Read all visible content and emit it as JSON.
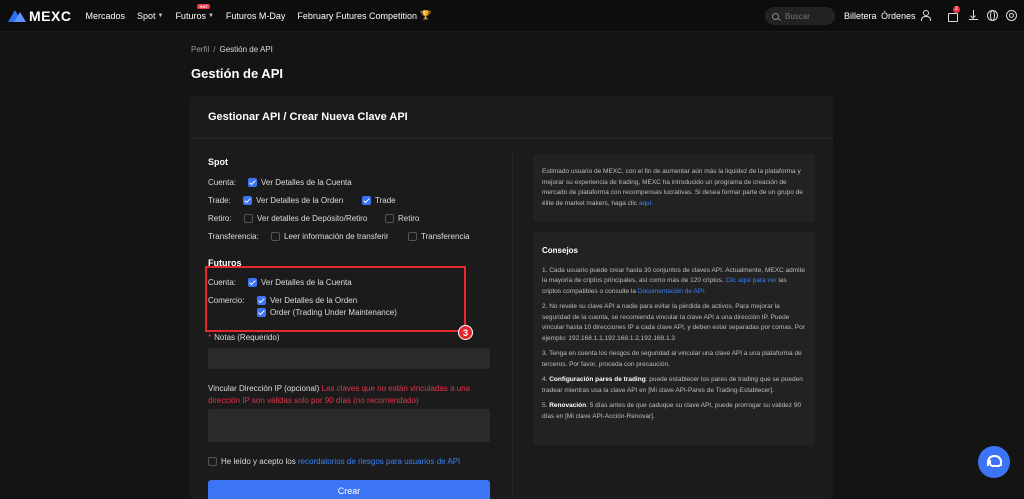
{
  "nav": {
    "logo": "MEXC",
    "items": [
      "Mercados",
      "Spot",
      "Futuros",
      "Futuros M-Day",
      "February Futures Competition"
    ],
    "hot_badge": "HOT",
    "search_placeholder": "Buscar",
    "wallet": "Billetera",
    "orders": "Órdenes",
    "notification_count": "2"
  },
  "breadcrumb": {
    "parent": "Perfil",
    "separator": "/",
    "current": "Gestión de API"
  },
  "page_title": "Gestión de API",
  "panel_title": "Gestionar API / Crear Nueva Clave API",
  "spot": {
    "title": "Spot",
    "cuenta_label": "Cuenta:",
    "cuenta_option": "Ver Detalles de la Cuenta",
    "trade_label": "Trade:",
    "trade_option1": "Ver Detalles de la Orden",
    "trade_option2": "Trade",
    "retiro_label": "Retiro:",
    "retiro_option1": "Ver detalles de Depósito/Retiro",
    "retiro_option2": "Retiro",
    "transfer_label": "Transferencia:",
    "transfer_option1": "Leer información de transferir",
    "transfer_option2": "Transferencia"
  },
  "futures": {
    "title": "Futuros",
    "cuenta_label": "Cuenta:",
    "cuenta_option": "Ver Detalles de la Cuenta",
    "comercio_label": "Comercio:",
    "comercio_option1": "Ver Detalles de la Orden",
    "comercio_option2": "Order (Trading Under Maintenance)"
  },
  "step_badge": "3",
  "notes": {
    "star": "*",
    "label": "Notas (Requerido)"
  },
  "ip": {
    "label": "Vincular Dirección IP (opcional)",
    "warning": "Las claves que no están vinculadas a una dirección IP son válidas solo por 90 días (no recomendado)"
  },
  "agree": {
    "text": "He leído y acepto los",
    "link": "recordatorios de riesgos para usuarios de API"
  },
  "create_button": "Crear",
  "info": {
    "text": "Estimado usuario de MEXC, con el fin de aumentar aún más la liquidez de la plataforma y mejorar su experiencia de trading, MEXC ha introducido un programa de creación de mercado de plataforma con recompensas lucrativas. Si desea formar parte de un grupo de élite de market makers, haga clic",
    "link": "aquí."
  },
  "tips": {
    "title": "Consejos",
    "item1_text": "1. Cada usuario puede crear hasta 30 conjuntos de claves API. Actualmente, MEXC admite la mayoría de criptos principales, así como más de 120 criptos.",
    "item1_link1": "Clic aquí para ver",
    "item1_mid": "las criptos compatibles o consulte la",
    "item1_link2": "Documentación de API.",
    "item2": "2. No revele su clave API a nadie para evitar la pérdida de activos. Para mejorar la seguridad de la cuenta, se recomienda vincular la clave API a una dirección IP. Puede vincular hasta 10 direcciones IP a cada clave API, y deben estar separadas por comas. Por ejemplo: 192.168.1.1,192.168.1.2,192.168.1.3",
    "item3": "3. Tenga en cuenta los riesgos de seguridad al vincular una clave API a una plataforma de terceros. Por favor, proceda con precaución.",
    "item4_prefix": "4.",
    "item4_bold": "Configuración pares de trading",
    "item4_text": ": puede establecer los pares de trading que se pueden tradear mientras usa la clave API en [Mi clave API-Pares de Trading-Establecer].",
    "item5_prefix": "5.",
    "item5_bold": "Renovación",
    "item5_text": ": 5 días antes de que caduque su clave API, puede prorrogar su validez 90 días en [Mi clave API-Acción-Renovar]."
  }
}
